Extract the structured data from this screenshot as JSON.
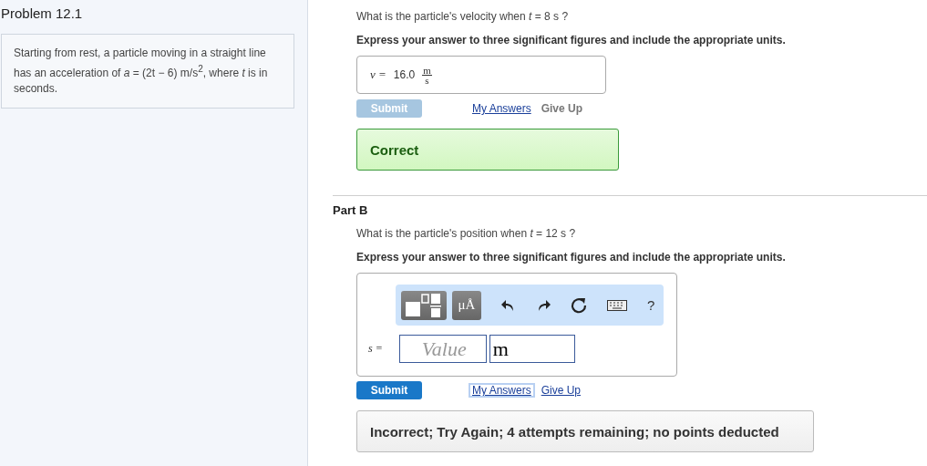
{
  "problem": {
    "title": "Problem 12.1",
    "statement": "Starting from rest, a particle moving in a straight line has an acceleration of *a* = (2t − 6) m/s$^{2}$, where *t* is in seconds."
  },
  "parts": [
    {
      "kind": "answered",
      "question": "What is the particle's velocity when *t* = 8  s ?",
      "instruction": "Express your answer to three significant figures and include the appropriate units.",
      "answer": {
        "variable": "v =",
        "value": "16.0",
        "unit_numerator": "m",
        "unit_denominator": "s"
      },
      "submit": {
        "label": "Submit",
        "disabled": true
      },
      "links": [
        {
          "label": "My Answers",
          "focused": false,
          "disabled": false
        },
        {
          "label": "Give Up",
          "focused": false,
          "disabled": true
        }
      ],
      "feedback": {
        "kind": "correct",
        "text": "Correct"
      }
    },
    {
      "kind": "input",
      "heading": "Part B",
      "question": "What is the particle's position when *t* = 12  s ?",
      "instruction": "Express your answer to three significant figures and include the appropriate units.",
      "toolbar": [
        {
          "kind": "template"
        },
        {
          "kind": "units",
          "label": "μÅ"
        },
        {
          "kind": "undo"
        },
        {
          "kind": "redo"
        },
        {
          "kind": "reset"
        },
        {
          "kind": "keyboard"
        },
        {
          "kind": "help",
          "label": "?"
        }
      ],
      "answer": {
        "variable": "s =",
        "placeholder": "Value",
        "unit": "m"
      },
      "submit": {
        "label": "Submit",
        "disabled": false
      },
      "links": [
        {
          "label": "My Answers",
          "focused": true,
          "disabled": false
        },
        {
          "label": "Give Up",
          "focused": false,
          "disabled": false
        }
      ],
      "feedback": {
        "kind": "incorrect",
        "text": "Incorrect; Try Again; 4 attempts remaining; no points deducted"
      }
    }
  ]
}
